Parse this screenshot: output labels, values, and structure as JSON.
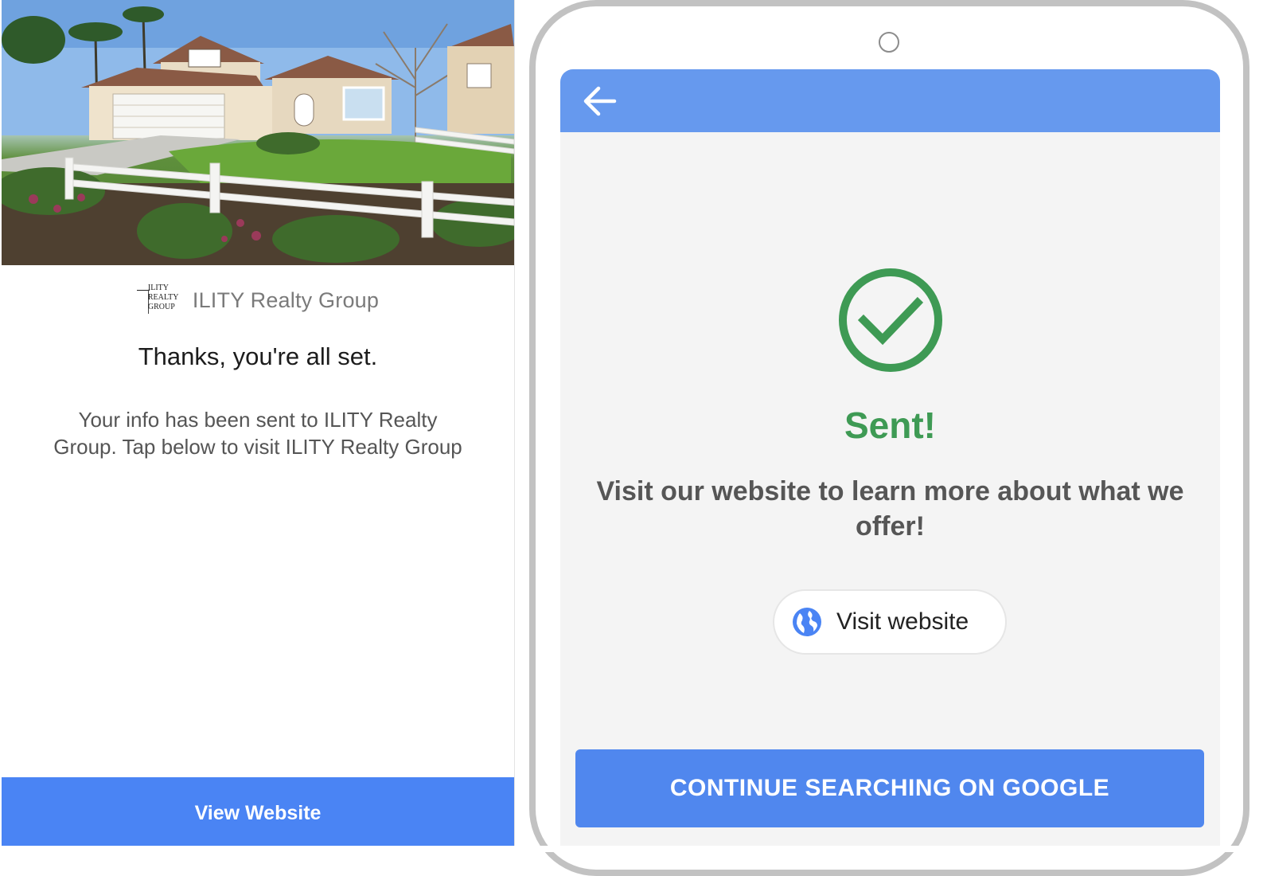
{
  "left": {
    "hero_alt": "house photo",
    "brand": {
      "logo_lines": [
        "ILITY",
        "REALTY",
        "GROUP"
      ],
      "name": "ILITY Realty Group"
    },
    "thanks": "Thanks, you're all set.",
    "info": "Your info has been sent to ILITY Realty Group. Tap below to visit ILITY Realty Group",
    "view_website_label": "View Website"
  },
  "right": {
    "back_icon": "arrow-left-icon",
    "status_icon": "check-circle-icon",
    "sent": "Sent!",
    "visit_text": "Visit our website to learn more about what we offer!",
    "visit_button_icon": "globe-icon",
    "visit_button_label": "Visit website",
    "continue_label": "CONTINUE SEARCHING ON GOOGLE"
  },
  "colors": {
    "left_button": "#4a84f4",
    "topbar": "#6699ee",
    "success_green": "#3e9a54",
    "continue_button": "#5087ee",
    "globe_blue": "#4a84f4"
  }
}
